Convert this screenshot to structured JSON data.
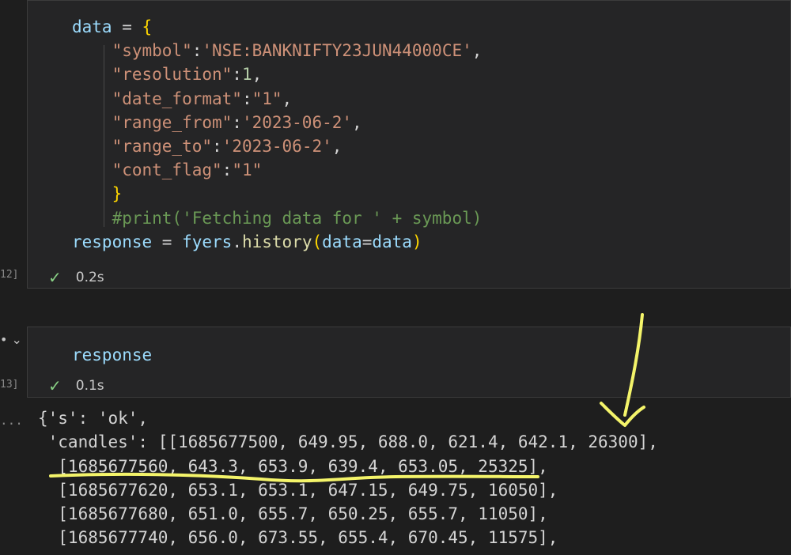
{
  "cell1": {
    "code_lines": [
      [
        "data",
        " = ",
        "{"
      ],
      [
        "\"symbol\"",
        ":",
        "'NSE:BANKNIFTY23JUN44000CE'",
        ","
      ],
      [
        "\"resolution\"",
        ":",
        "1",
        ","
      ],
      [
        "\"date_format\"",
        ":",
        "\"1\"",
        ","
      ],
      [
        "\"range_from\"",
        ":",
        "'2023-06-2'",
        ","
      ],
      [
        "\"range_to\"",
        ":",
        "'2023-06-2'",
        ","
      ],
      [
        "\"cont_flag\"",
        ":",
        "\"1\""
      ],
      [
        "}"
      ],
      [
        "#print('Fetching data for ' + symbol)"
      ],
      [
        "response",
        " = ",
        "fyers",
        ".",
        "history",
        "(",
        "data",
        "=",
        "data",
        ")"
      ]
    ],
    "exec_count": "12]",
    "status_time": "0.2s"
  },
  "cell2": {
    "code": "response",
    "exec_count": "13]",
    "status_time": "0.1s"
  },
  "output": {
    "lines": [
      "{'s': 'ok',",
      " 'candles': [[1685677500, 649.95, 688.0, 621.4, 642.1, 26300],",
      "  [1685677560, 643.3, 653.9, 639.4, 653.05, 25325],",
      "  [1685677620, 653.1, 653.1, 647.15, 649.75, 16050],",
      "  [1685677680, 651.0, 655.7, 650.25, 655.7, 11050],",
      "  [1685677740, 656.0, 673.55, 655.4, 670.45, 11575],"
    ],
    "prompt": "..."
  },
  "colors": {
    "annotation": "#f4f46a"
  },
  "icons": {
    "status": "check-icon",
    "collapse": "chevron-down-icon"
  }
}
